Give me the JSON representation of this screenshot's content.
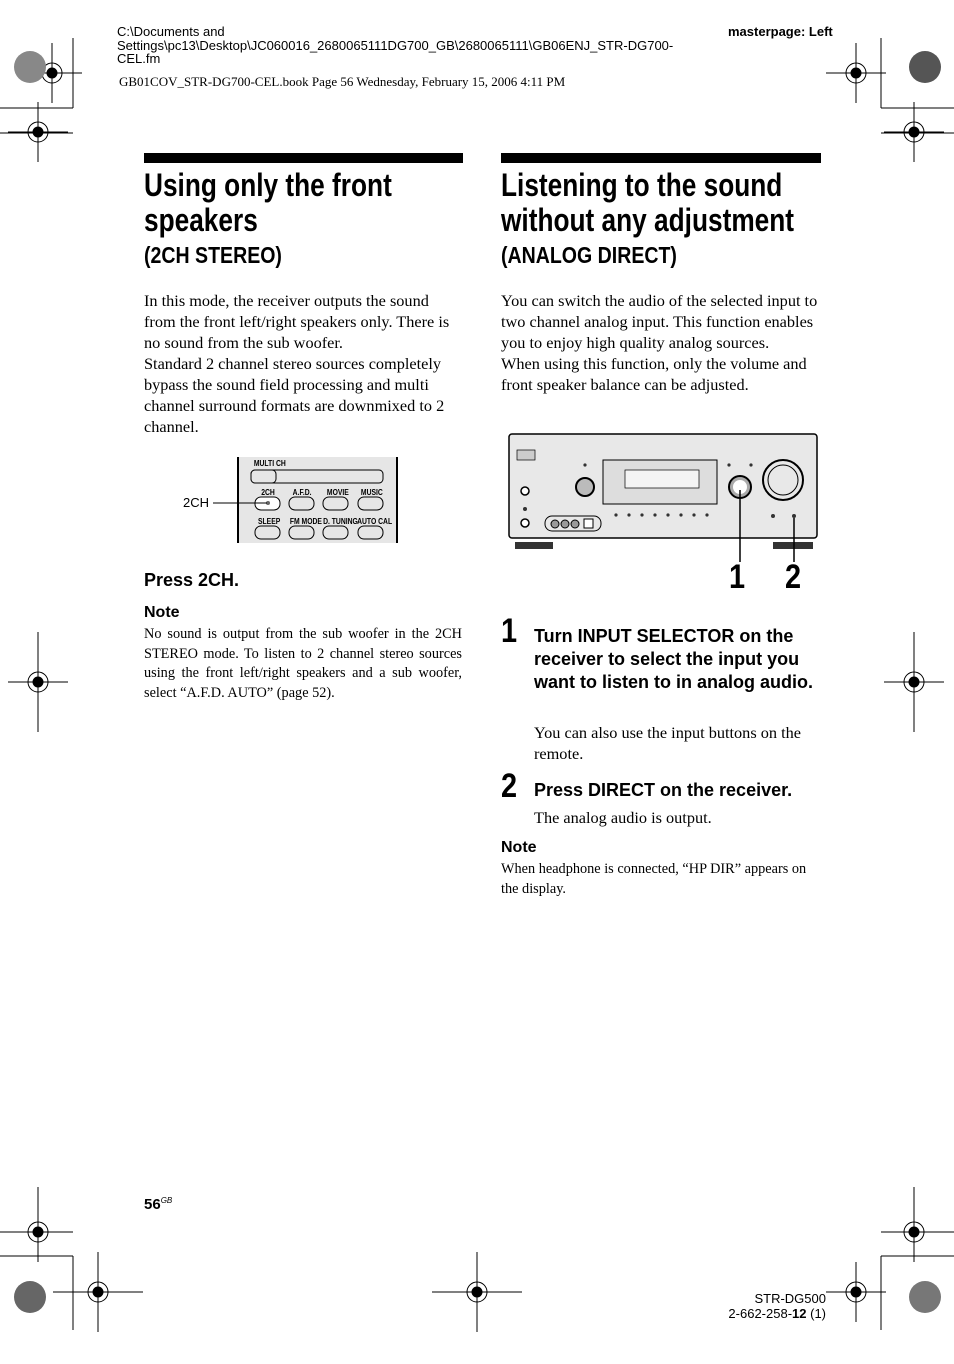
{
  "header": {
    "path_line1": "C:\\Documents and",
    "path_line2": "Settings\\pc13\\Desktop\\JC060016_2680065111DG700_GB\\2680065111\\GB06ENJ_STR-DG700-",
    "path_line3": "CEL.fm",
    "masterpage": "masterpage: Left",
    "book_info": "GB01COV_STR-DG700-CEL.book  Page 56  Wednesday, February 15, 2006  4:11 PM"
  },
  "left": {
    "title_line1": "Using only the front",
    "title_line2": "speakers",
    "subtitle": "(2CH STEREO)",
    "para1": "In this mode, the receiver outputs the sound from the front left/right speakers only. There is no sound from the sub woofer.",
    "para2": "Standard 2 channel stereo sources completely bypass the sound field processing and multi channel surround formats are downmixed to 2 channel.",
    "remote": {
      "callout": "2CH",
      "buttons": [
        "MULTI CH",
        "2CH",
        "A.F.D.",
        "MOVIE",
        "MUSIC",
        "SLEEP",
        "FM MODE",
        "D. TUNING",
        "AUTO CAL"
      ]
    },
    "instruction": "Press 2CH.",
    "note_heading": "Note",
    "note_text": "No sound is output from the sub woofer in the 2CH STEREO mode. To listen to 2 channel stereo sources using the front left/right speakers and a sub woofer, select “A.F.D. AUTO” (page 52)."
  },
  "right": {
    "title_line1": "Listening to the sound",
    "title_line2": "without any adjustment",
    "subtitle": "(ANALOG DIRECT)",
    "para1": "You can switch the audio of the selected input to two channel analog input. This function enables you to enjoy high quality analog sources.",
    "para2": "When using this function, only the volume and front speaker balance can be adjusted.",
    "figure_callouts": [
      "1",
      "2"
    ],
    "steps": [
      {
        "num": "1",
        "heading": "Turn INPUT SELECTOR on the receiver to select the input you want to listen to in analog audio.",
        "text": "You can also use the input buttons on the remote."
      },
      {
        "num": "2",
        "heading": "Press DIRECT on the receiver.",
        "text": "The analog audio is output."
      }
    ],
    "note_heading": "Note",
    "note_text": "When headphone is connected, “HP DIR” appears on the display."
  },
  "footer": {
    "page_number": "56",
    "page_suffix": "GB",
    "model": "STR-DG500",
    "code_prefix": "2-662-258-",
    "code_bold": "12",
    "code_suffix": " (1)"
  }
}
